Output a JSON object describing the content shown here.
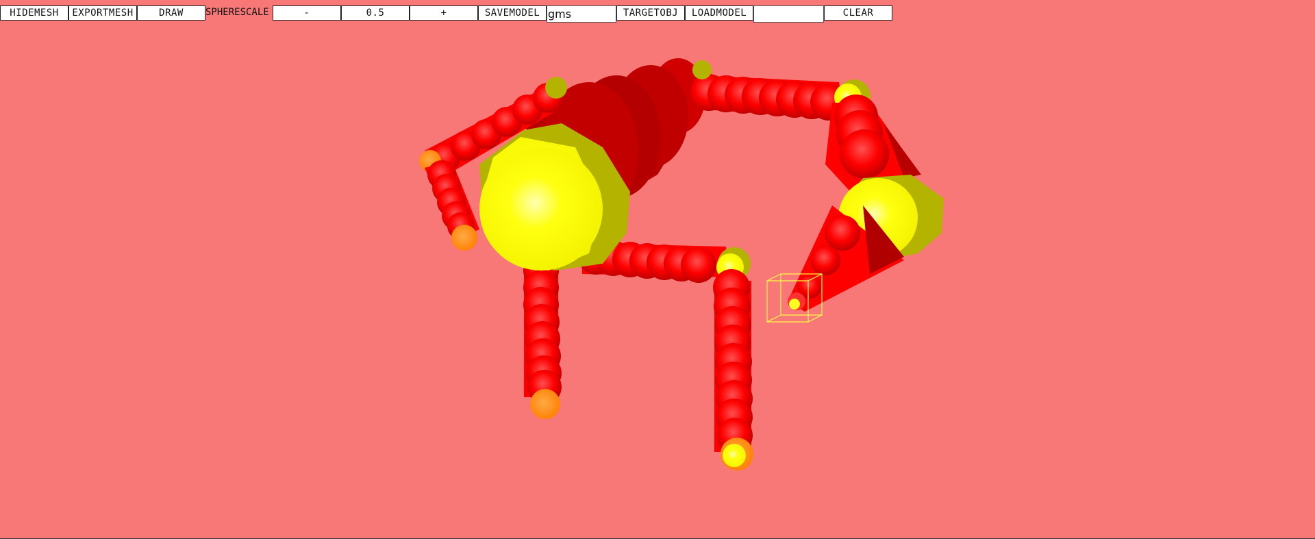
{
  "toolbar": {
    "hidemesh_label": "HIDEMESH",
    "exportmesh_label": "EXPORTMESH",
    "draw_label": "DRAW",
    "spherescale_label": "SPHERESCALE",
    "minus_label": "-",
    "scale_value": "0.5",
    "plus_label": "+",
    "savemodel_label": "SAVEMODEL",
    "model_name_value": "gms",
    "targetobj_label": "TARGETOBJ",
    "loadmodel_label": "LOADMODEL",
    "load_input_value": "",
    "clear_label": "CLEAR"
  },
  "colors": {
    "background": "#f87878",
    "sphere_red": "#ff0000",
    "sphere_dark_red": "#b00000",
    "joint_yellow": "#ffff00",
    "joint_olive": "#b3b300",
    "tip_orange": "#ff8800",
    "target_box": "#ffff44"
  },
  "scene": {
    "description_icon": "sphere-mesh-model"
  }
}
